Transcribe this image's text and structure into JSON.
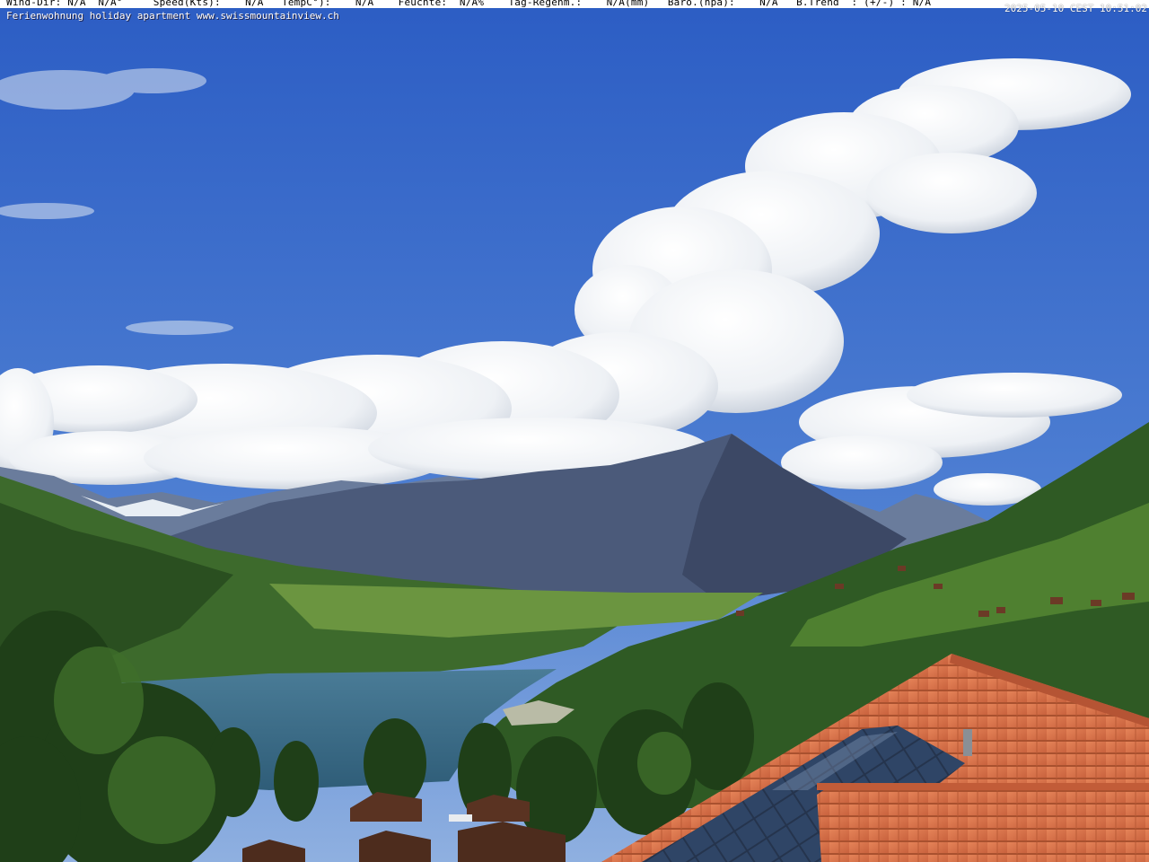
{
  "overlay": {
    "weather_line": "Wind-Dir: N/A  N/A°     Speed(Kts):    N/A   TempC°):    N/A    Feuchte:  N/A%    Tag-Regenm.:    N/A(mm)   Baro.(hpa):    N/A   B.Trend  : (+/-) : N/A",
    "timestamp": "2025-05-10 CEST 10:51:02",
    "caption": "Ferienwohnung holiday apartment www.swissmountainview.ch"
  },
  "scene": {
    "subject": "webcam view over a lake with a pyramid-shaped mountain, alpine range and cumulus clouds, tiled rooftop with solar panels in foreground",
    "colors": {
      "sky_top": "#2c5dc4",
      "sky_horizon": "#7ea6df",
      "cloud": "#f4f6f8",
      "cloud_shade": "#b9c3d1",
      "mountain": "#4a5878",
      "mountain_shadow": "#36405a",
      "snow": "#e8eef4",
      "lake": "#3e6f8a",
      "forest_dark": "#1e3d1a",
      "forest": "#2f5a24",
      "meadow": "#5e8f35",
      "roof_tile": "#d9714a",
      "solar_panel": "#27364f"
    }
  }
}
